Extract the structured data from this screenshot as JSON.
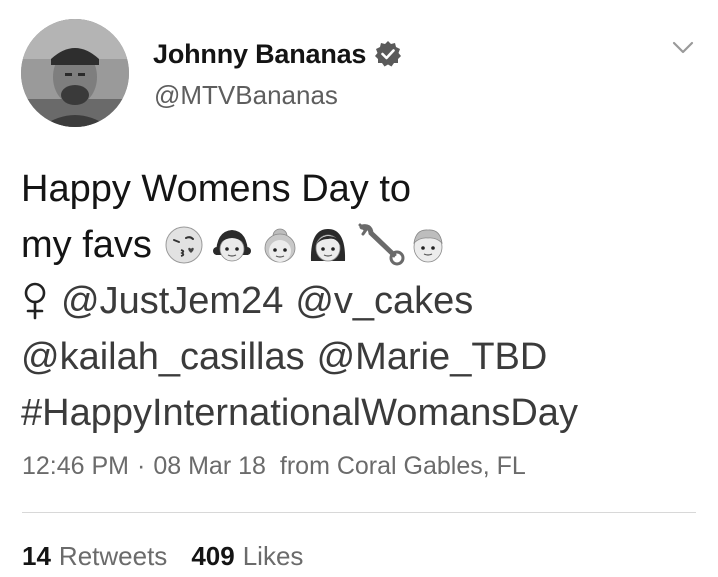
{
  "user": {
    "display_name": "Johnny Bananas",
    "handle": "@MTVBananas",
    "verified": true,
    "avatar_icon": "profile-photo"
  },
  "tweet": {
    "line1": "Happy Womens Day to",
    "line2_text": "my favs",
    "emojis": [
      "kissing-face-icon",
      "girl-icon",
      "older-woman-icon",
      "woman-icon",
      "wrench-icon",
      "boy-icon",
      "female-sign-icon"
    ],
    "mentions": [
      "@JustJem24",
      "@v_cakes",
      "@kailah_casillas",
      "@Marie_TBD"
    ],
    "hashtag": "#HappyInternationalWomansDay"
  },
  "meta": {
    "time": "12:46 PM",
    "separator": "·",
    "date": "08 Mar 18",
    "location": "from Coral Gables, FL"
  },
  "stats": {
    "retweets_count": "14",
    "retweets_label": "Retweets",
    "likes_count": "409",
    "likes_label": "Likes"
  },
  "colors": {
    "text": "#141414",
    "secondary": "#6b6b6b",
    "background": "#ffffff"
  }
}
